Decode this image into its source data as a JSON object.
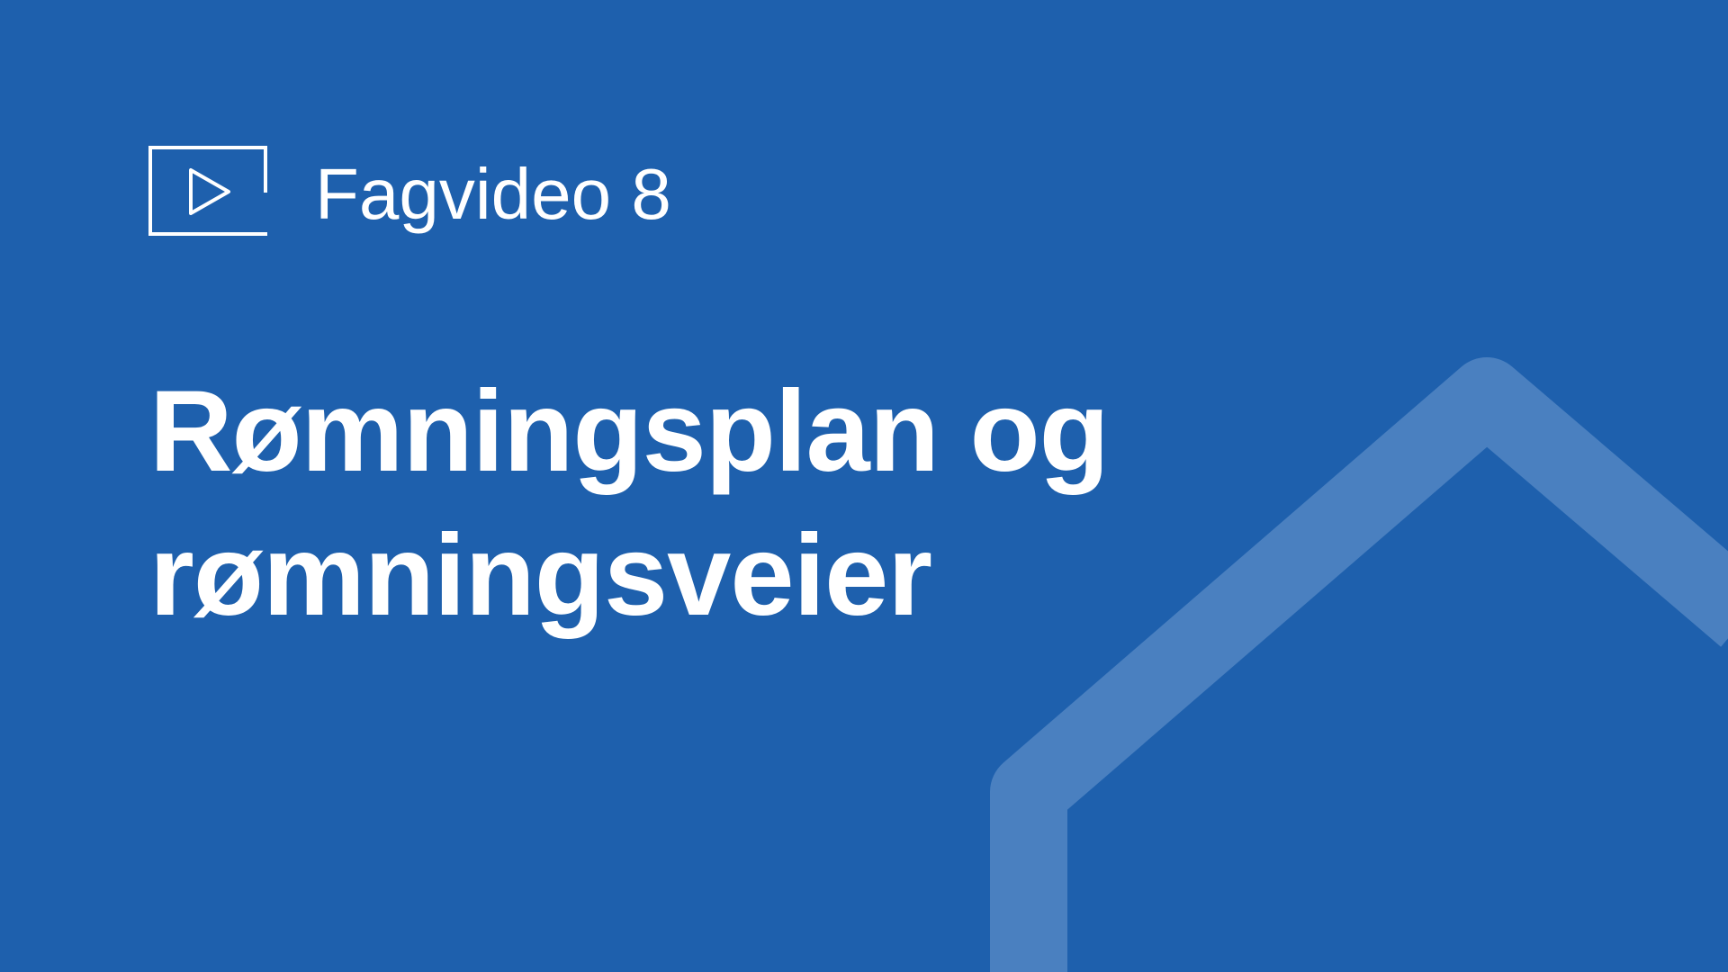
{
  "slide": {
    "kicker": "Fagvideo 8",
    "title_line_1": "Rømningsplan og",
    "title_line_2": "rømningsveier"
  },
  "icons": {
    "video": "video-play-icon",
    "decoration": "house-outline"
  },
  "colors": {
    "background": "#1e60ad",
    "text": "#ffffff",
    "house_outline": "#4a80c0"
  }
}
